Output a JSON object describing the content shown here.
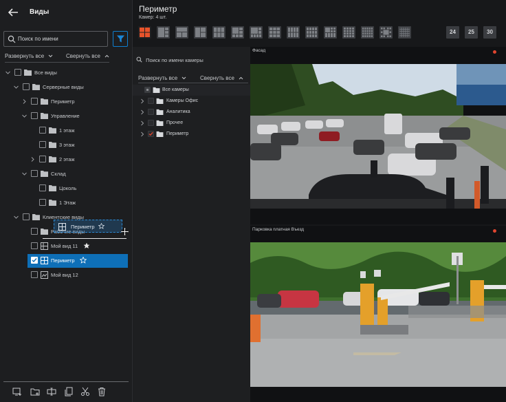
{
  "left_panel": {
    "title": "Виды",
    "search_placeholder": "Поиск по имени",
    "expand_all": "Развернуть все",
    "collapse_all": "Свернуть все",
    "tree": {
      "all_views": "Все виды",
      "server_views": "Серверные виды",
      "perimeter": "Периметр",
      "management": "Управление",
      "floor_1": "1 этаж",
      "floor_3": "3 этаж",
      "floor_2": "2 этаж",
      "warehouse": "Склад",
      "basement": "Цоколь",
      "floor_1b": "1 Этаж",
      "client_views": "Клиентские виды",
      "subfolder": "Рабочие виды",
      "my_view_11": "Мой вид 11",
      "perimeter_view": "Периметр",
      "my_view_12": "Мой вид 12"
    },
    "drag_label": "Периметр"
  },
  "main": {
    "title": "Периметр",
    "subtitle": "Камер: 4 шт.",
    "layout_numbers": [
      "24",
      "25",
      "30"
    ]
  },
  "camera_list": {
    "search_placeholder": "Поиск по имени камеры",
    "expand_all": "Развернуть все",
    "collapse_all": "Свернуть все",
    "items": {
      "all_cameras": "Все камеры",
      "office_cameras": "Камеры Офис",
      "analytics": "Аналитика",
      "other": "Прочее",
      "perimeter": "Периметр"
    }
  },
  "tiles": [
    {
      "title": "Фасад"
    },
    {
      "title": "Парковка платная Въезд"
    }
  ],
  "colors": {
    "accent": "#0e6fb7",
    "layout_active": "#e8532b",
    "recording": "#e0452f"
  }
}
